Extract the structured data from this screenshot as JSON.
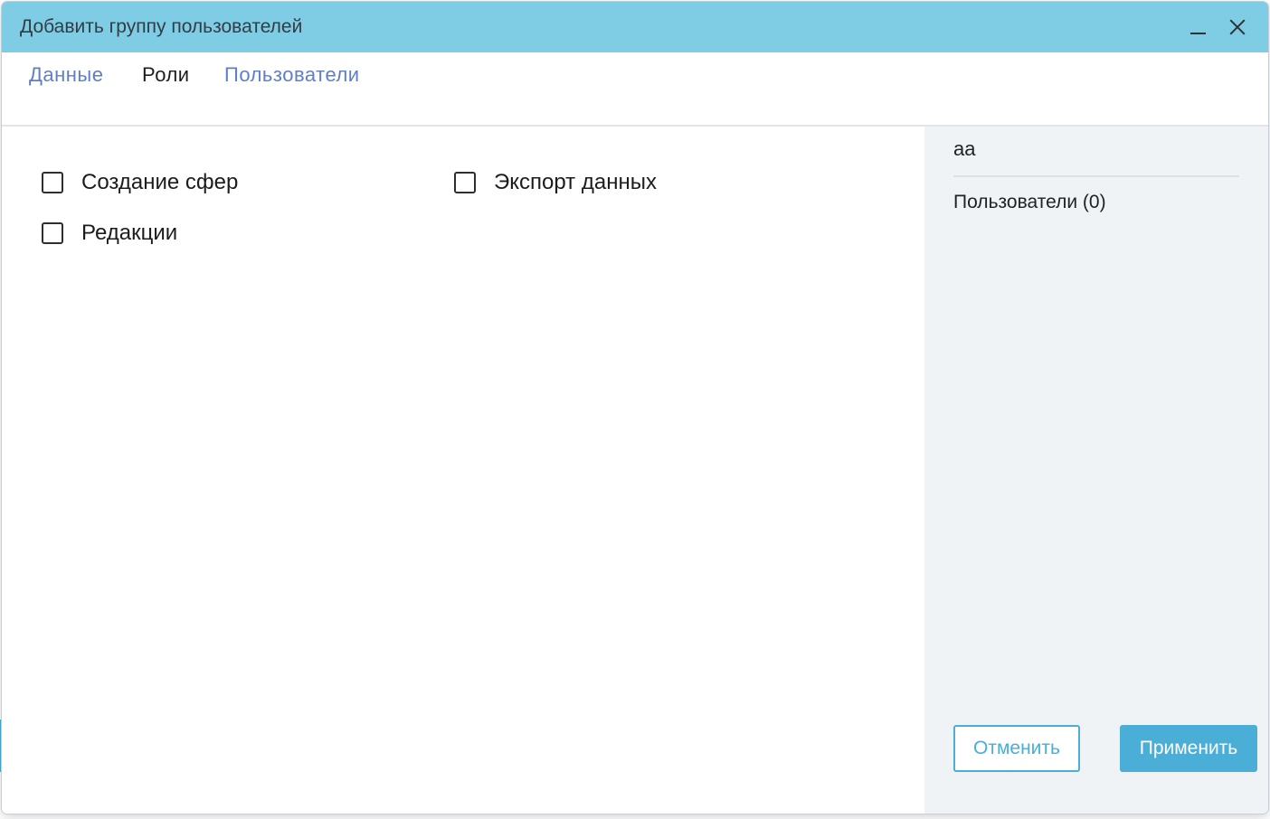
{
  "dialog": {
    "title": "Добавить группу пользователей"
  },
  "tabs": [
    {
      "label": "Данные",
      "active": false
    },
    {
      "label": "Роли",
      "active": true
    },
    {
      "label": "Пользователи",
      "active": false
    }
  ],
  "roles": [
    {
      "label": "Создание сфер",
      "checked": false
    },
    {
      "label": "Экспорт данных",
      "checked": false
    },
    {
      "label": "Редакции",
      "checked": false
    }
  ],
  "side": {
    "group_name": "aa",
    "users_label": "Пользователи (0)"
  },
  "buttons": {
    "cancel": "Отменить",
    "apply": "Применить"
  },
  "colors": {
    "titlebar": "#7ecde4",
    "accent": "#4aaed6",
    "tab_link": "#5e7fc8",
    "side_panel": "#eff3f6"
  },
  "icons": {
    "minimize": "minimize-icon",
    "close": "close-icon"
  }
}
